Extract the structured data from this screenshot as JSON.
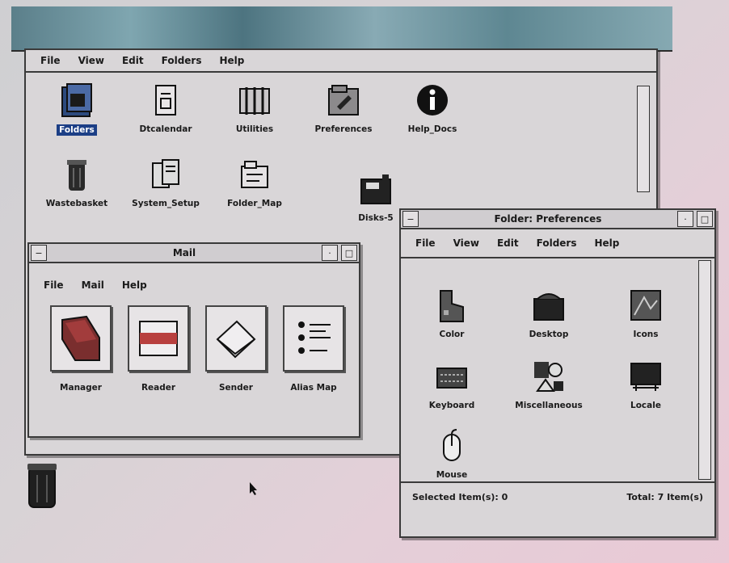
{
  "main_window": {
    "menu": [
      "File",
      "View",
      "Edit",
      "Folders",
      "Help"
    ],
    "icons": [
      {
        "label": "Folders",
        "icon": "folders-icon",
        "selected": true
      },
      {
        "label": "Dtcalendar",
        "icon": "calendar-icon"
      },
      {
        "label": "Utilities",
        "icon": "utilities-icon"
      },
      {
        "label": "Preferences",
        "icon": "preferences-icon"
      },
      {
        "label": "Help_Docs",
        "icon": "info-icon"
      },
      {
        "label": "Wastebasket",
        "icon": "wastebasket-icon"
      },
      {
        "label": "System_Setup",
        "icon": "system-setup-icon"
      },
      {
        "label": "Folder_Map",
        "icon": "folder-map-icon"
      },
      {
        "label": "Disks-5",
        "icon": "disk-icon"
      }
    ]
  },
  "mail_window": {
    "title": "Mail",
    "menu": [
      "File",
      "Mail",
      "Help"
    ],
    "items": [
      {
        "label": "Manager",
        "icon": "manager-icon"
      },
      {
        "label": "Reader",
        "icon": "reader-icon"
      },
      {
        "label": "Sender",
        "icon": "sender-icon"
      },
      {
        "label": "Alias Map",
        "icon": "alias-map-icon"
      }
    ]
  },
  "prefs_window": {
    "title": "Folder: Preferences",
    "menu": [
      "File",
      "View",
      "Edit",
      "Folders",
      "Help"
    ],
    "items": [
      {
        "label": "Color",
        "icon": "color-icon"
      },
      {
        "label": "Desktop",
        "icon": "desktop-icon"
      },
      {
        "label": "Icons",
        "icon": "icons-icon"
      },
      {
        "label": "Keyboard",
        "icon": "keyboard-icon"
      },
      {
        "label": "Miscellaneous",
        "icon": "miscellaneous-icon"
      },
      {
        "label": "Locale",
        "icon": "locale-icon"
      },
      {
        "label": "Mouse",
        "icon": "mouse-icon"
      }
    ],
    "status_left": "Selected Item(s): 0",
    "status_right": "Total: 7 Item(s)"
  },
  "colors": {
    "selection": "#1c3f86",
    "window_bg": "#d9d6d8",
    "border": "#3a3a3a"
  }
}
